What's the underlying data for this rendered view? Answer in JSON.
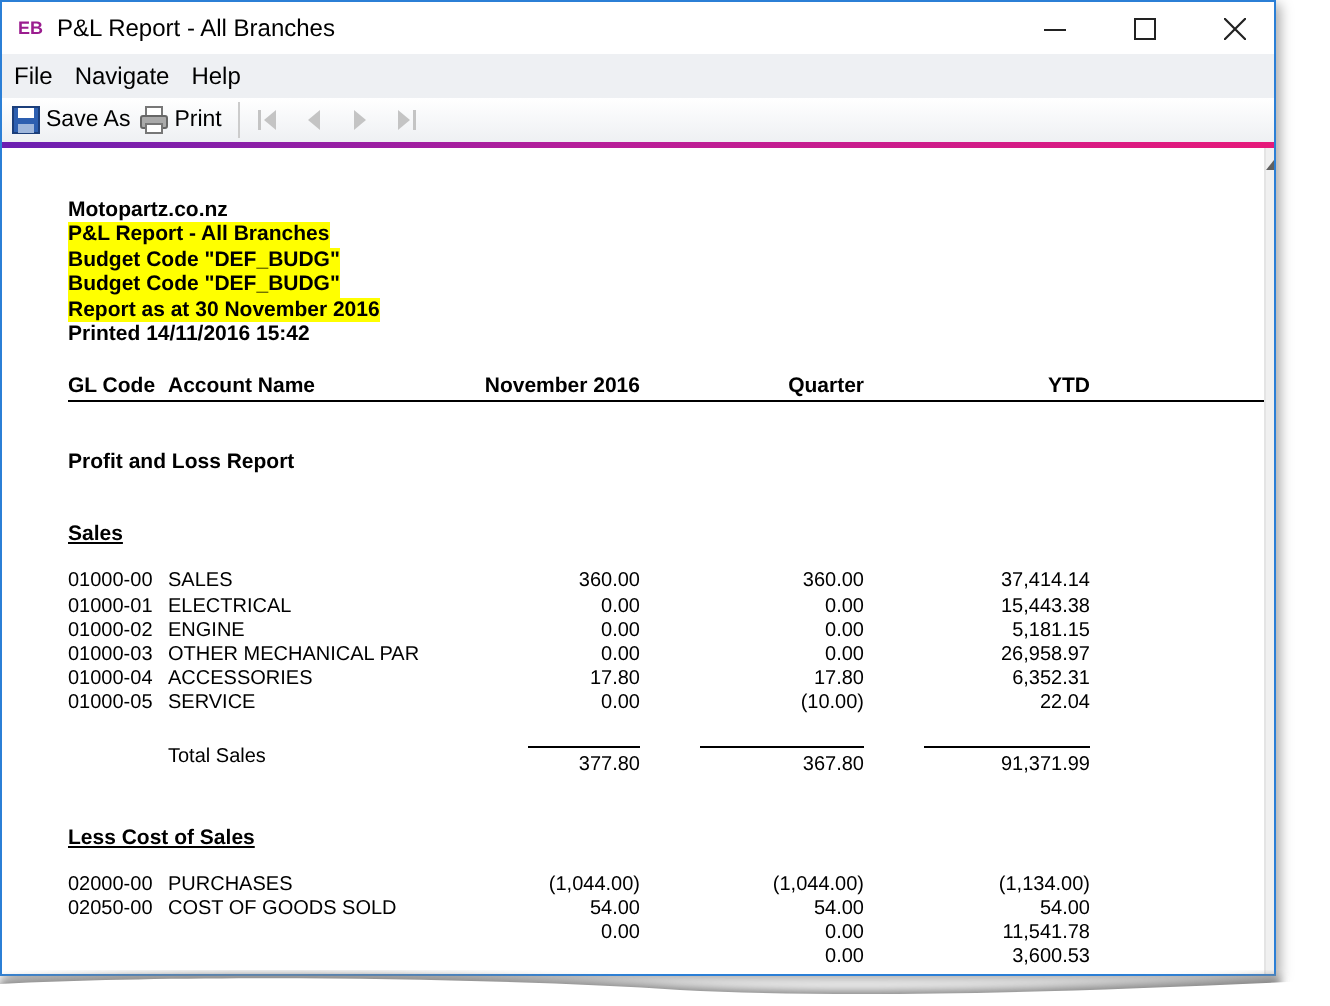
{
  "window": {
    "app_badge": "EB",
    "title": "P&L Report - All Branches"
  },
  "menu": [
    "File",
    "Navigate",
    "Help"
  ],
  "toolbar": [
    {
      "kind": "save",
      "label": "Save As",
      "disabled": false
    },
    {
      "kind": "print",
      "label": "Print",
      "disabled": false
    },
    {
      "kind": "first",
      "disabled": true
    },
    {
      "kind": "prev",
      "disabled": true
    },
    {
      "kind": "next",
      "disabled": true
    },
    {
      "kind": "last",
      "disabled": true
    }
  ],
  "report": {
    "header_lines": [
      {
        "text": "Motopartz.co.nz",
        "highlighted": false
      },
      {
        "text": "P&L Report - All Branches",
        "highlighted": true
      },
      {
        "text": "Budget Code \"DEF_BUDG\"",
        "highlighted": true
      },
      {
        "text": "Budget Code \"DEF_BUDG\"",
        "highlighted": true
      },
      {
        "text": "Report as at 30 November 2016",
        "highlighted": true
      },
      {
        "text": "Printed 14/11/2016 15:42",
        "highlighted": false
      }
    ],
    "columns": [
      "GL Code",
      "Account Name",
      "November 2016",
      "Quarter",
      "YTD"
    ],
    "title": "Profit and Loss Report",
    "sections": [
      {
        "title": "Sales",
        "rows": [
          {
            "code": "01000-00",
            "name": "SALES",
            "values": [
              "360.00",
              "360.00",
              "37,414.14"
            ]
          },
          {
            "code": "01000-01",
            "name": "ELECTRICAL",
            "values": [
              "0.00",
              "0.00",
              "15,443.38"
            ]
          },
          {
            "code": "01000-02",
            "name": "ENGINE",
            "values": [
              "0.00",
              "0.00",
              "5,181.15"
            ]
          },
          {
            "code": "01000-03",
            "name": "OTHER MECHANICAL PAR",
            "values": [
              "0.00",
              "0.00",
              "26,958.97"
            ]
          },
          {
            "code": "01000-04",
            "name": "ACCESSORIES",
            "values": [
              "17.80",
              "17.80",
              "6,352.31"
            ]
          },
          {
            "code": "01000-05",
            "name": "SERVICE",
            "values": [
              "0.00",
              "(10.00)",
              "22.04"
            ]
          }
        ],
        "total": {
          "label": "Total Sales",
          "values": [
            "377.80",
            "367.80",
            "91,371.99"
          ]
        }
      },
      {
        "title": "Less Cost of Sales",
        "rows": [
          {
            "code": "02000-00",
            "name": "PURCHASES",
            "values": [
              "(1,044.00)",
              "(1,044.00)",
              "(1,134.00)"
            ]
          },
          {
            "code": "02050-00",
            "name": "COST OF GOODS SOLD",
            "values": [
              "54.00",
              "54.00",
              "54.00"
            ]
          },
          {
            "november": "0.00",
            "quarter": "0.00",
            "ytd": "11,541.78"
          },
          {
            "quarter": "0.00",
            "ytd": "3,600.53"
          }
        ]
      }
    ]
  }
}
